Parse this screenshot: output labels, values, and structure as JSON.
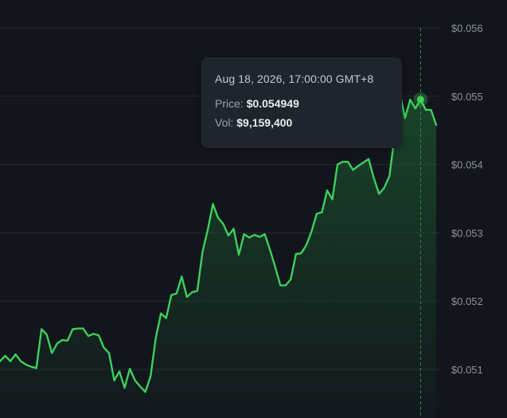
{
  "colors": {
    "background": "#12161c",
    "gridline": "#232a33",
    "line": "#3ecf5c",
    "area_top": "#1f6b35",
    "crosshair": "#2f8a4a",
    "tooltip_bg": "#1f252d"
  },
  "tooltip": {
    "date": "Aug 18, 2026, 17:00:00 GMT+8",
    "price_label": "Price:",
    "price_value": "$0.054949",
    "vol_label": "Vol:",
    "vol_value": "$9,159,400"
  },
  "chart_data": {
    "type": "area",
    "title": "",
    "xlabel": "",
    "ylabel": "",
    "ylim": [
      0.0504,
      0.0566
    ],
    "y_ticks": [
      {
        "value": 0.056,
        "label": "$0.056"
      },
      {
        "value": 0.055,
        "label": "$0.055"
      },
      {
        "value": 0.054,
        "label": "$0.054"
      },
      {
        "value": 0.053,
        "label": "$0.053"
      },
      {
        "value": 0.052,
        "label": "$0.052"
      },
      {
        "value": 0.051,
        "label": "$0.051"
      }
    ],
    "grid": true,
    "legend": "none",
    "y_axis_position": "right",
    "highlight_index": 81,
    "series": [
      {
        "values": [
          0.05112,
          0.0512,
          0.05112,
          0.05122,
          0.05112,
          0.05107,
          0.05104,
          0.05102,
          0.05159,
          0.05151,
          0.05124,
          0.05138,
          0.05143,
          0.05142,
          0.05159,
          0.0516,
          0.0516,
          0.05149,
          0.05152,
          0.0515,
          0.05132,
          0.05124,
          0.05084,
          0.05097,
          0.05073,
          0.05101,
          0.05084,
          0.05075,
          0.05067,
          0.0509,
          0.05146,
          0.05182,
          0.05175,
          0.05209,
          0.05211,
          0.05236,
          0.05206,
          0.05213,
          0.05215,
          0.05272,
          0.05304,
          0.05342,
          0.05322,
          0.05313,
          0.05296,
          0.05306,
          0.05268,
          0.05298,
          0.05293,
          0.05297,
          0.05294,
          0.05298,
          0.05275,
          0.0525,
          0.05223,
          0.05223,
          0.05232,
          0.05269,
          0.0527,
          0.05282,
          0.05302,
          0.05328,
          0.0533,
          0.05362,
          0.05349,
          0.054,
          0.05404,
          0.05404,
          0.05392,
          0.05398,
          0.05403,
          0.05408,
          0.0538,
          0.05357,
          0.05366,
          0.05383,
          0.05442,
          0.05505,
          0.05468,
          0.05495,
          0.05482,
          0.05495,
          0.0548,
          0.0548,
          0.05458
        ]
      }
    ]
  }
}
